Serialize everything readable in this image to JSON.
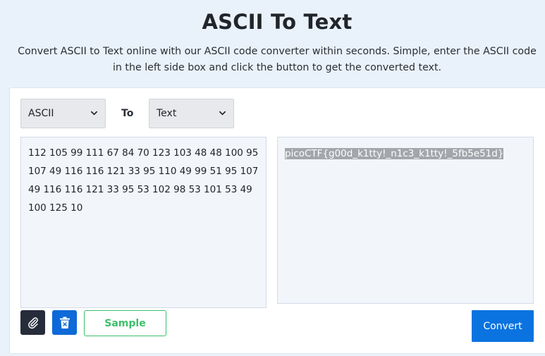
{
  "header": {
    "title": "ASCII To Text",
    "subtitle": "Convert ASCII to Text online with our ASCII code converter within seconds. Simple, enter the ASCII code in the left side box and click the button to get the converted text."
  },
  "converter": {
    "from_select": {
      "selected": "ASCII"
    },
    "to_label": "To",
    "to_select": {
      "selected": "Text"
    },
    "input_value": "112 105 99 111 67 84 70 123 103 48 48 100 95 107 49 116 116 121 33 95 110 49 99 51 95 107 49 116 116 121 33 95 53 102 98 53 101 53 49 100 125 10",
    "output_value": "picoCTF{g00d_k1tty!_n1c3_k1tty!_5fb5e51d}",
    "buttons": {
      "attach_icon": "paperclip-icon",
      "clear_icon": "trash-icon",
      "sample_label": "Sample",
      "convert_label": "Convert"
    }
  },
  "colors": {
    "page_bg": "#e9f1fa",
    "accent": "#0b73e0",
    "sample_green": "#3bbf6a",
    "dark_button": "#272c3b"
  }
}
